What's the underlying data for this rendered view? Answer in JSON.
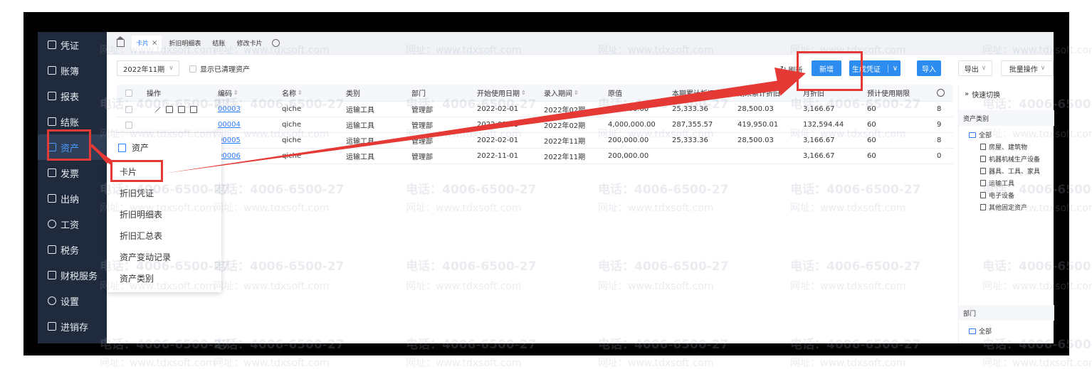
{
  "sidebar": {
    "items": [
      {
        "label": "凭证"
      },
      {
        "label": "账簿"
      },
      {
        "label": "报表"
      },
      {
        "label": "结账"
      },
      {
        "label": "资产"
      },
      {
        "label": "发票"
      },
      {
        "label": "出纳"
      },
      {
        "label": "工资"
      },
      {
        "label": "税务"
      },
      {
        "label": "财税服务"
      },
      {
        "label": "设置"
      },
      {
        "label": "进销存"
      }
    ],
    "active": "资产"
  },
  "tabs": [
    {
      "label": "卡片",
      "close": "×"
    },
    {
      "label": "折旧明细表"
    },
    {
      "label": "结账"
    },
    {
      "label": "修改卡片"
    }
  ],
  "toolbar": {
    "period": "2022年11期",
    "show_cleared_label": "显示已清理资产",
    "refresh_label": "刷新",
    "new_label": "新增",
    "gen_voucher_label": "生成凭证",
    "import_label": "导入",
    "export_label": "导出",
    "batch_label": "批量操作"
  },
  "table": {
    "headers": [
      "操作",
      "编码",
      "名称",
      "类别",
      "部门",
      "开始使用日期",
      "录入期间",
      "原值",
      "本期累计折旧",
      "期末累计折旧",
      "月折旧",
      "预计使用期限",
      ""
    ],
    "rows": [
      {
        "code": "00003",
        "name": "qiche",
        "category": "运输工具",
        "dept": "管理部",
        "start": "2022-02-01",
        "period": "2022年02期",
        "orig": "200,000.00",
        "cur_dep": "25,333.36",
        "end_dep": "28,500.03",
        "month_dep": "3,166.67",
        "life": "60",
        "extra": "8"
      },
      {
        "code": "00004",
        "name": "qiche",
        "category": "运输工具",
        "dept": "管理部",
        "start": "2022-01-01",
        "period": "2022年02期",
        "orig": "4,000,000.00",
        "cur_dep": "287,355.57",
        "end_dep": "419,950.01",
        "month_dep": "132,594.44",
        "life": "60",
        "extra": "9"
      },
      {
        "code": "00005",
        "name": "qiche",
        "category": "运输工具",
        "dept": "管理部",
        "start": "2022-02-01",
        "period": "2022年11期",
        "orig": "200,000.00",
        "cur_dep": "25,333.36",
        "end_dep": "28,500.03",
        "month_dep": "3,166.67",
        "life": "60",
        "extra": "8"
      },
      {
        "code": "00006",
        "name": "qiche",
        "category": "运输工具",
        "dept": "管理部",
        "start": "2022-11-01",
        "period": "2022年11期",
        "orig": "200,000.00",
        "cur_dep": "",
        "end_dep": "",
        "month_dep": "3,166.67",
        "life": "60",
        "extra": "0"
      }
    ]
  },
  "quick_panel": {
    "title": "快速切换",
    "asset_type_label": "资产类别",
    "asset_types": [
      "全部",
      "房屋、建筑物",
      "机器机械生产设备",
      "器具、工具、家具",
      "运输工具",
      "电子设备",
      "其他固定资产"
    ],
    "dept_label": "部门",
    "dept_items": [
      "全部"
    ]
  },
  "dropdown": {
    "header": "资产",
    "items": [
      "卡片",
      "折旧凭证",
      "折旧明细表",
      "折旧汇总表",
      "资产变动记录",
      "资产类别"
    ]
  },
  "watermark": {
    "phone": "电话：4006-6500-27",
    "url": "网址：www.tdxsoft.com"
  },
  "colors": {
    "primary": "#2d8cf0",
    "sidebar_bg": "#1f2a3c",
    "highlight": "#e53935"
  }
}
